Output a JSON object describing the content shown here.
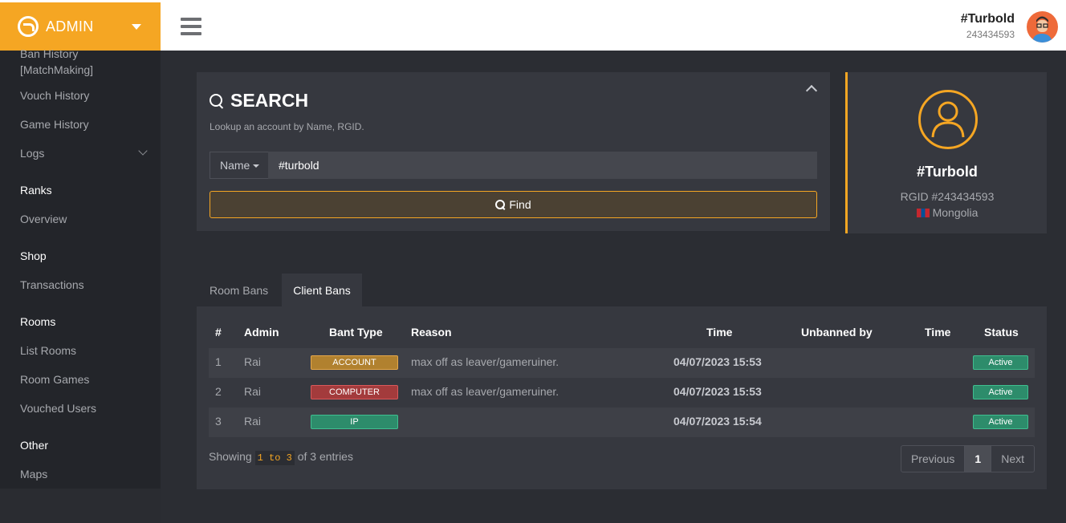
{
  "brand": {
    "title": "ADMIN",
    "accent": "#f5a623"
  },
  "user": {
    "name": "#Turbold",
    "id": "243434593"
  },
  "sidebar": {
    "items": [
      {
        "label": "Ban History\n[MatchMaking]",
        "type": "item"
      },
      {
        "label": "Vouch History",
        "type": "item"
      },
      {
        "label": "Game History",
        "type": "item"
      },
      {
        "label": "Logs",
        "type": "item"
      },
      {
        "label": "Ranks",
        "type": "head"
      },
      {
        "label": "Overview",
        "type": "item"
      },
      {
        "label": "Shop",
        "type": "head"
      },
      {
        "label": "Transactions",
        "type": "item"
      },
      {
        "label": "Rooms",
        "type": "head"
      },
      {
        "label": "List Rooms",
        "type": "item"
      },
      {
        "label": "Room Games",
        "type": "item"
      },
      {
        "label": "Vouched Users",
        "type": "item"
      },
      {
        "label": "Other",
        "type": "head"
      },
      {
        "label": "Maps",
        "type": "item"
      }
    ]
  },
  "search": {
    "title": "SEARCH",
    "subtitle": "Lookup an account by Name, RGID.",
    "select_value": "Name",
    "input_value": "#turbold",
    "find_label": "Find"
  },
  "profile": {
    "name": "#Turbold",
    "rgid": "RGID #243434593",
    "country": "Mongolia"
  },
  "tabs": [
    {
      "label": "Room Bans",
      "active": false
    },
    {
      "label": "Client Bans",
      "active": true
    }
  ],
  "table": {
    "headers": [
      "#",
      "Admin",
      "Bant Type",
      "Reason",
      "Time",
      "Unbanned by",
      "Time",
      "Status"
    ],
    "rows": [
      {
        "num": "1",
        "admin": "Rai",
        "type": "ACCOUNT",
        "reason": "max off as leaver/gameruiner.",
        "time": "04/07/2023 15:53",
        "unbanned_by": "",
        "time2": "",
        "status": "Active"
      },
      {
        "num": "2",
        "admin": "Rai",
        "type": "COMPUTER",
        "reason": "max off as leaver/gameruiner.",
        "time": "04/07/2023 15:53",
        "unbanned_by": "",
        "time2": "",
        "status": "Active"
      },
      {
        "num": "3",
        "admin": "Rai",
        "type": "IP",
        "reason": "",
        "time": "04/07/2023 15:54",
        "unbanned_by": "",
        "time2": "",
        "status": "Active"
      }
    ],
    "showing_prefix": "Showing",
    "showing_range": "1 to 3",
    "showing_suffix": "of 3 entries",
    "pager": {
      "prev": "Previous",
      "page": "1",
      "next": "Next"
    }
  }
}
